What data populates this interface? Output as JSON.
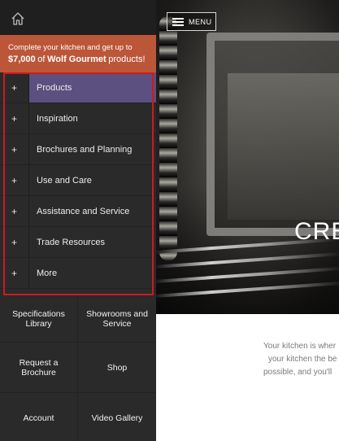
{
  "header": {
    "home_icon": "home-icon",
    "menu_label": "MENU"
  },
  "promo": {
    "line1": "Complete your kitchen and get up to",
    "amount": "$7,000",
    "of": "of",
    "brand": "Wolf Gourmet",
    "suffix": "products!"
  },
  "nav": {
    "items": [
      {
        "expander": "+",
        "label": "Products"
      },
      {
        "expander": "+",
        "label": "Inspiration"
      },
      {
        "expander": "+",
        "label": "Brochures and Planning"
      },
      {
        "expander": "+",
        "label": "Use and Care"
      },
      {
        "expander": "+",
        "label": "Assistance and Service"
      },
      {
        "expander": "+",
        "label": "Trade Resources"
      },
      {
        "expander": "+",
        "label": "More"
      }
    ]
  },
  "quick_links": [
    "Specifications Library",
    "Showrooms and Service",
    "Request a Brochure",
    "Shop",
    "Account",
    "Video Gallery"
  ],
  "hero": {
    "headline_partial": "CRE"
  },
  "intro": {
    "line1": "Your kitchen is wher",
    "line2": "your kitchen the be",
    "line3": "possible, and you'll"
  },
  "colors": {
    "panel_bg": "#2a2a2a",
    "promo_bg": "#bc5639",
    "active_item_bg": "#5b5080",
    "highlight_border": "#d1191b"
  }
}
